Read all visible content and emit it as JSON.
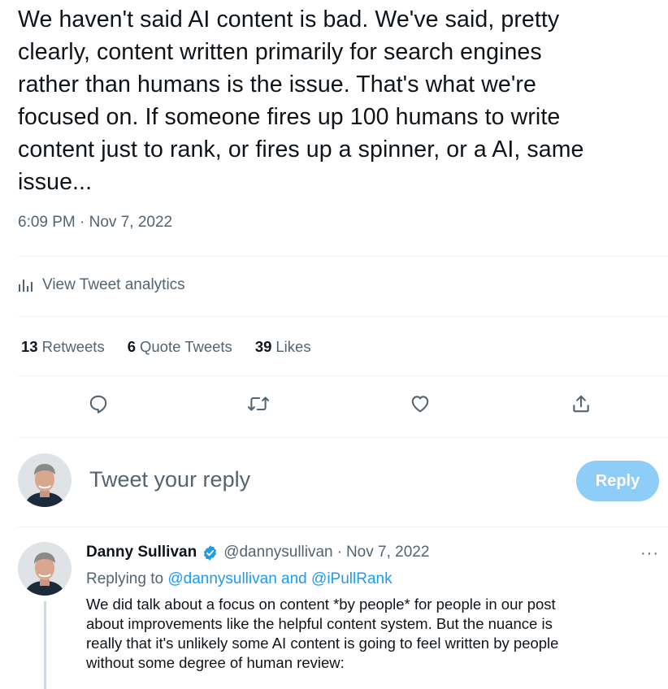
{
  "tweet": {
    "text_lines": [
      "We haven't said AI content is bad. We've said, pretty",
      "clearly, content written primarily for search engines",
      "rather than humans is the issue. That's what we're",
      "focused on. If someone fires up 100 humans to write",
      "content just to rank, or fires up a spinner, or a AI, same",
      "issue..."
    ],
    "timestamp": "6:09 PM · Nov 7, 2022",
    "analytics_label": "View Tweet analytics",
    "stats": {
      "retweets_count": "13",
      "retweets_label": "Retweets",
      "quotes_count": "6",
      "quotes_label": "Quote Tweets",
      "likes_count": "39",
      "likes_label": "Likes"
    }
  },
  "actions": {
    "icons": [
      "reply-icon",
      "retweet-icon",
      "like-icon",
      "share-icon"
    ]
  },
  "composer": {
    "placeholder": "Tweet your reply",
    "button_label": "Reply"
  },
  "reply": {
    "author_name": "Danny Sullivan",
    "handle": "@dannysullivan",
    "separator": "·",
    "date": "Nov 7, 2022",
    "more_label": "···",
    "replying_prefix": "Replying to",
    "replying_mention_1": "@dannysullivan",
    "replying_and": "and",
    "replying_mention_2": "@iPullRank",
    "text_lines": [
      "We did talk about a focus on content *by people* for people in our post",
      "about improvements like the helpful content system. But the nuance is",
      "really that it's unlikely some AI content is going to feel written by people",
      "without some degree of human review:"
    ]
  },
  "colors": {
    "text": "#0f1419",
    "secondary": "#536471",
    "accent": "#1d9bf0",
    "reply_button_disabled": "#8ecdf8",
    "divider": "#eff3f4"
  }
}
